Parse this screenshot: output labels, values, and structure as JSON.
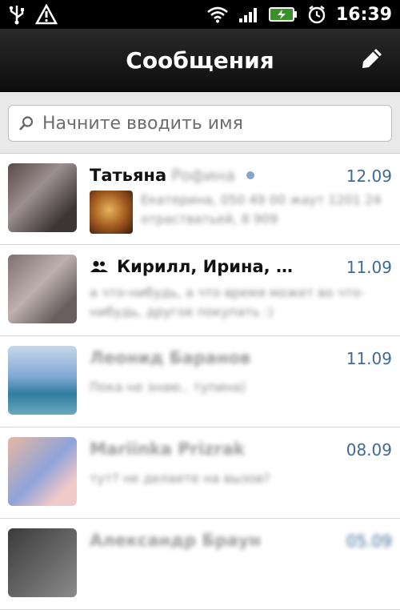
{
  "status_bar": {
    "time": "16:39",
    "icons": [
      "usb-icon",
      "warning-icon",
      "wifi-icon",
      "signal-icon",
      "battery-icon",
      "alarm-icon"
    ]
  },
  "header": {
    "title": "Сообщения",
    "edit_icon": "pencil-icon"
  },
  "search": {
    "placeholder": "Начните вводить имя"
  },
  "conversations": [
    {
      "name": "Татьяна",
      "name_blurred": "Рофина",
      "date": "12.09",
      "unread": true,
      "preview_blurred": "Екатерина, 050 49 00 жаут 1201 24 отрастватьей, 8 909"
    },
    {
      "name": "Кирилл, Ирина, …",
      "group": true,
      "date": "11.09",
      "preview_blurred": "а что-нибудь, а что время может во что-нибудь, другое покупать :)"
    },
    {
      "name_blurred": "Леонид Баранов",
      "date": "11.09",
      "preview_blurred": "Пока не знаю.. тупина)"
    },
    {
      "name_blurred": "Mariinka Prizrak",
      "date": "08.09",
      "preview_blurred": "тут? не делаете на вызов?"
    },
    {
      "name_blurred": "Александр Браун",
      "date_blurred": "05.09",
      "preview_blurred": ""
    }
  ],
  "colors": {
    "header_bg": "#111111",
    "date_color": "#3e6a96",
    "unread_dot": "#86a6c8"
  }
}
